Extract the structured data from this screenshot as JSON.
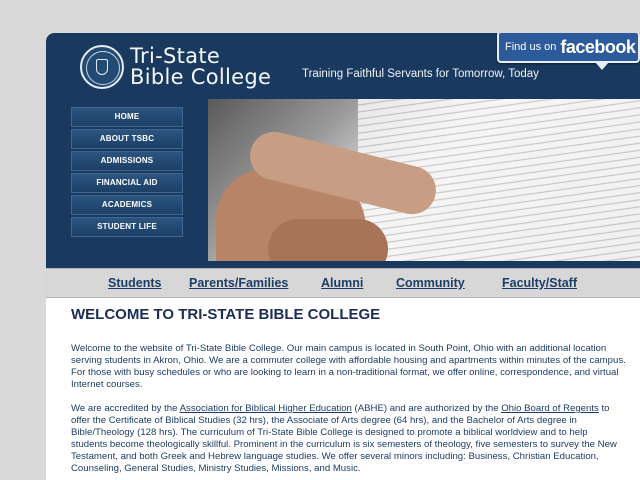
{
  "header": {
    "logo_line1": "Tri-State",
    "logo_line2": "Bible College",
    "tagline": "Training Faithful Servants for Tomorrow, Today",
    "facebook_pre": "Find us on",
    "facebook_brand": "facebook"
  },
  "nav": {
    "items": [
      {
        "label": "HOME"
      },
      {
        "label": "ABOUT TSBC"
      },
      {
        "label": "ADMISSIONS"
      },
      {
        "label": "FINANCIAL AID"
      },
      {
        "label": "ACADEMICS"
      },
      {
        "label": "STUDENT LIFE"
      }
    ]
  },
  "subnav": {
    "items": [
      {
        "label": "Students"
      },
      {
        "label": "Parents/Families"
      },
      {
        "label": "Alumni"
      },
      {
        "label": "Community"
      },
      {
        "label": "Faculty/Staff"
      }
    ]
  },
  "main": {
    "heading": "WELCOME TO TRI-STATE BIBLE COLLEGE",
    "p1": "Welcome to the website of Tri-State Bible College. Our main campus is located in South Point, Ohio with an additional location serving students in Akron, Ohio. We are a commuter college with affordable housing and apartments within minutes of the campus. For those with busy schedules or who are looking to learn in a non-traditional format, we offer online, correspondence, and virtual Internet courses.",
    "p2_a": "We are accredited by the ",
    "p2_link1": "Association for Biblical Higher Education",
    "p2_b": " (ABHE) and are authorized by the ",
    "p2_link2": "Ohio Board of Regents",
    "p2_c": " to offer the Certificate of Biblical Studies (32 hrs), the Associate of Arts degree (64 hrs), and the Bachelor of Arts degree in Bible/Theology (128 hrs). The curriculum of Tri-State Bible College is designed to promote a biblical worldview and to help students become theologically skillful. Prominent in the curriculum is six semesters of theology, five semesters to survey the New Testament, and both Greek and Hebrew language studies. We offer several minors including: Business, Christian Education, Counseling, General Studies, Ministry Studies, Missions, and Music."
  }
}
